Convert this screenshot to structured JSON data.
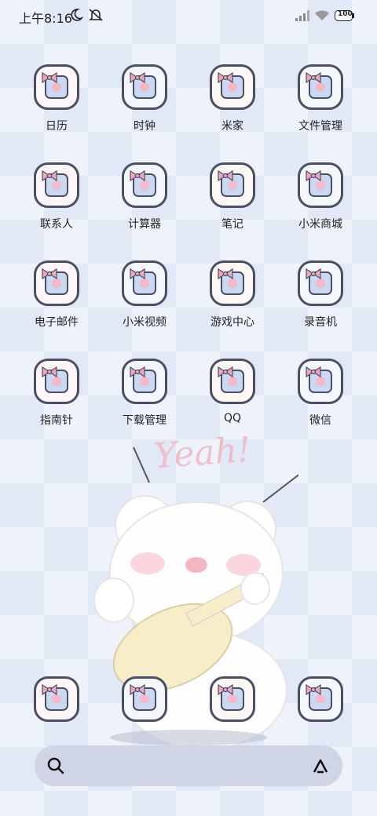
{
  "status": {
    "time": "上午8:16",
    "battery": "100"
  },
  "apps": [
    {
      "label": "日历",
      "icon": "calendar-icon"
    },
    {
      "label": "时钟",
      "icon": "clock-icon"
    },
    {
      "label": "米家",
      "icon": "mijia-icon"
    },
    {
      "label": "文件管理",
      "icon": "folder-icon"
    },
    {
      "label": "联系人",
      "icon": "contacts-icon"
    },
    {
      "label": "计算器",
      "icon": "calculator-icon"
    },
    {
      "label": "笔记",
      "icon": "notes-icon"
    },
    {
      "label": "小米商城",
      "icon": "store-icon"
    },
    {
      "label": "电子邮件",
      "icon": "email-icon"
    },
    {
      "label": "小米视频",
      "icon": "video-icon"
    },
    {
      "label": "游戏中心",
      "icon": "gamepad-icon"
    },
    {
      "label": "录音机",
      "icon": "recorder-icon"
    },
    {
      "label": "指南针",
      "icon": "compass-icon"
    },
    {
      "label": "下载管理",
      "icon": "download-icon"
    },
    {
      "label": "QQ",
      "icon": "qq-icon"
    },
    {
      "label": "微信",
      "icon": "wechat-icon"
    }
  ],
  "dock": [
    {
      "icon": "phone-icon"
    },
    {
      "icon": "messages-icon"
    },
    {
      "icon": "browser-icon"
    },
    {
      "icon": "camera-icon"
    }
  ],
  "wallpaper_text": "Yeah!",
  "colors": {
    "icon_border": "#4a4f66",
    "bow_pink": "#f2a7b8",
    "searchbar": "#cfd5e4"
  }
}
